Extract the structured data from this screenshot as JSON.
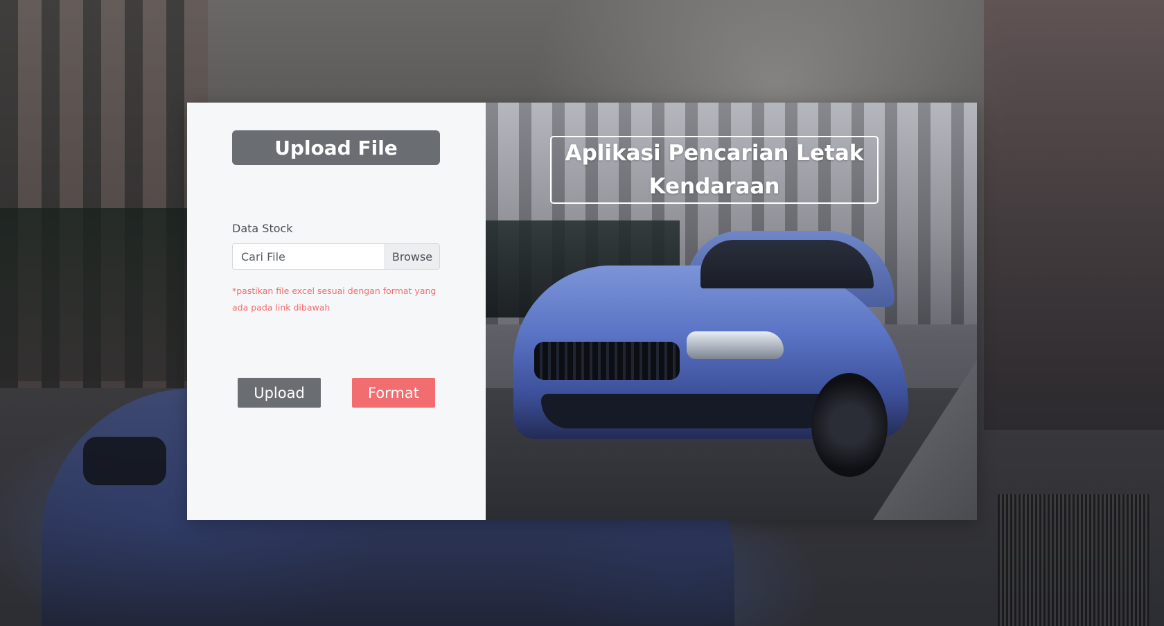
{
  "upload_panel": {
    "title": "Upload File",
    "field_label": "Data Stock",
    "file_placeholder": "Cari File",
    "browse_label": "Browse",
    "hint": "*pastikan file excel sesuai dengan format yang ada pada link dibawah",
    "upload_button": "Upload",
    "format_button": "Format"
  },
  "hero_panel": {
    "title": "Aplikasi Pencarian Letak Kendaraan"
  },
  "colors": {
    "panel_bg": "#f6f7f9",
    "primary_gray": "#6a6e73",
    "accent_red": "#f26d70",
    "hint_red": "#f26d6d"
  }
}
